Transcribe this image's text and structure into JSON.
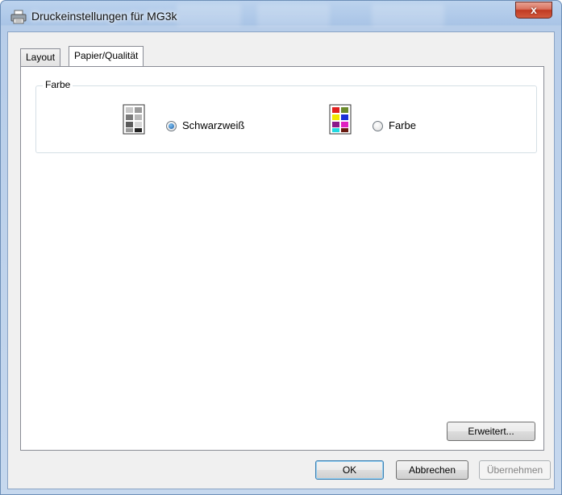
{
  "window": {
    "title": "Druckeinstellungen für MG3k",
    "close_glyph": "x"
  },
  "tabs": [
    {
      "label": "Layout",
      "active": false
    },
    {
      "label": "Papier/Qualität",
      "active": true
    }
  ],
  "color_group": {
    "label": "Farbe",
    "options": [
      {
        "label": "Schwarzweiß",
        "checked": true,
        "icon": "grayscale-page-icon"
      },
      {
        "label": "Farbe",
        "checked": false,
        "icon": "color-page-icon"
      }
    ]
  },
  "buttons": {
    "advanced": "Erweitert...",
    "ok": "OK",
    "cancel": "Abbrechen",
    "apply": "Übernehmen"
  },
  "colors": {
    "accent": "#3c7fb1",
    "close_button": "#c03a22"
  }
}
